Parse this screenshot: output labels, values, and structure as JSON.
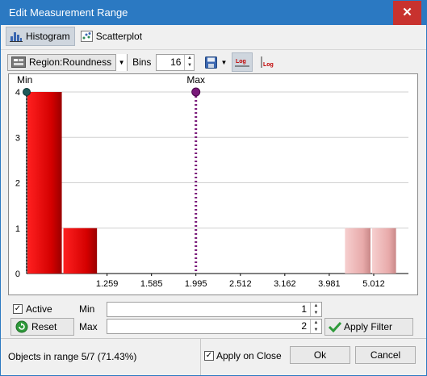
{
  "window": {
    "title": "Edit Measurement Range",
    "close_glyph": "✕"
  },
  "tabs": [
    {
      "label": "Histogram",
      "icon": "histogram-icon",
      "active": true
    },
    {
      "label": "Scatterplot",
      "icon": "scatterplot-icon",
      "active": false
    }
  ],
  "toolbar": {
    "region": "Region:Roundness",
    "bins_label": "Bins",
    "bins_value": "16",
    "log_x_label": "Log",
    "log_y_label": "Log"
  },
  "chart_data": {
    "type": "bar",
    "x_scale": "log",
    "xlim": [
      0.83,
      6.0
    ],
    "ylim": [
      0,
      4
    ],
    "y_ticks": [
      "0",
      "1",
      "2",
      "3",
      "4"
    ],
    "x_ticks": [
      "1.259",
      "1.585",
      "1.995",
      "2.512",
      "3.162",
      "3.981",
      "5.012"
    ],
    "x_tick_values": [
      1.259,
      1.585,
      1.995,
      2.512,
      3.162,
      3.981,
      5.012
    ],
    "bins": [
      {
        "from": 0.83,
        "to": 1.0,
        "count": 4,
        "in_range": true
      },
      {
        "from": 1.0,
        "to": 1.2,
        "count": 1,
        "in_range": true
      },
      {
        "from": 4.3,
        "to": 4.95,
        "count": 1,
        "in_range": false
      },
      {
        "from": 4.95,
        "to": 5.65,
        "count": 1,
        "in_range": false
      }
    ],
    "min_marker": {
      "label": "Min",
      "value": 0.83
    },
    "max_marker": {
      "label": "Max",
      "value": 1.995
    },
    "colors": {
      "in_range": "#e00000",
      "out_range": "#f0b8b8",
      "max": "#7a1a7a",
      "min": "#1f5a5a",
      "grid": "#d0d0d0"
    },
    "grid": true
  },
  "controls": {
    "active_label": "Active",
    "active_checked": true,
    "min_label": "Min",
    "min_value": "1",
    "max_label": "Max",
    "max_value": "2",
    "reset_label": "Reset",
    "apply_filter_label": "Apply Filter"
  },
  "status": {
    "objects_text": "Objects in range 5/7 (71.43%)",
    "apply_on_close_label": "Apply on Close",
    "apply_on_close_checked": true,
    "ok_label": "Ok",
    "cancel_label": "Cancel"
  }
}
